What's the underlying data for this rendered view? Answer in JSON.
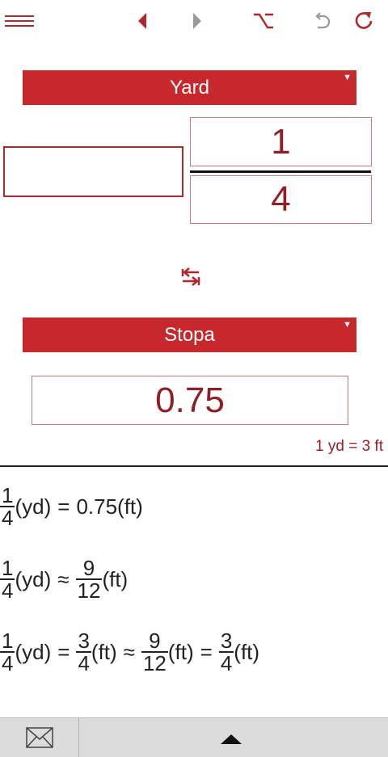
{
  "from_unit": {
    "label": "Yard"
  },
  "input": {
    "whole": "",
    "numerator": "1",
    "denominator": "4"
  },
  "to_unit": {
    "label": "Stopa"
  },
  "output": {
    "value": "0.75"
  },
  "conversion_ratio": "1 yd = 3 ft",
  "results": [
    {
      "lhs_num": "1",
      "lhs_den": "4",
      "lhs_unit": "(yd)",
      "op": "=",
      "value": "0.75",
      "unit": "(ft)"
    },
    {
      "lhs_num": "1",
      "lhs_den": "4",
      "lhs_unit": "(yd)",
      "op": "≈",
      "num": "9",
      "den": "12",
      "unit": "(ft)"
    },
    {
      "lhs_num": "1",
      "lhs_den": "4",
      "lhs_unit": "(yd)",
      "op1": "=",
      "a_num": "3",
      "a_den": "4",
      "a_unit": "(ft)",
      "op2": "≈",
      "b_num": "9",
      "b_den": "12",
      "b_unit": "(ft)",
      "op3": "=",
      "c_num": "3",
      "c_den": "4",
      "c_unit": "(ft)"
    }
  ],
  "colors": {
    "accent": "#c6282c",
    "text_dark_red": "#8f1f24"
  },
  "icons": {
    "menu": "hamburger-icon",
    "back": "triangle-left-icon",
    "forward": "triangle-right-icon",
    "option": "option-key-icon",
    "undo": "undo-icon",
    "reset": "refresh-icon",
    "swap": "swap-arrows-icon",
    "mail": "envelope-icon",
    "expand": "triangle-up-icon"
  }
}
